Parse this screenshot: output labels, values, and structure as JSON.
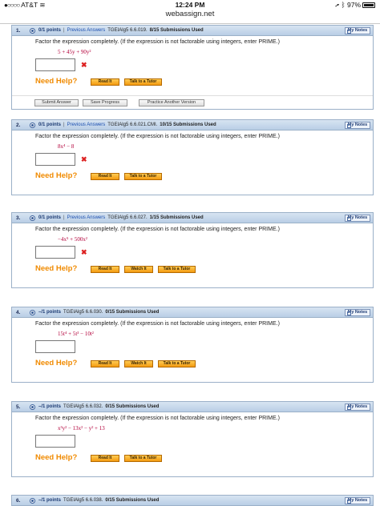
{
  "status": {
    "carrier": "AT&T",
    "time": "12:24 PM",
    "battery": "97%",
    "url": "webassign.net"
  },
  "common": {
    "prompt": "Factor the expression completely. (If the expression is not factorable using integers, enter PRIME.)",
    "need_help": "Need Help?",
    "read_it": "Read It",
    "watch_it": "Watch It",
    "talk_tutor": "Talk to a Tutor",
    "my_notes": "My Notes",
    "prev_answers": "Previous Answers",
    "sep": "|",
    "wrong_mark": "✖"
  },
  "actions": {
    "submit": "Submit Answer",
    "save": "Save Progress",
    "practice": "Practice Another Version"
  },
  "questions": [
    {
      "num": "1.",
      "points": "0/1 points",
      "code": "TGEIAlg5 6.6.019.",
      "subs": "8/15 Submissions Used",
      "expr": "5 + 45y + 90y²"
    },
    {
      "num": "2.",
      "points": "0/1 points",
      "code": "TGEIAlg5 6.6.021.CMI.",
      "subs": "10/15 Submissions Used",
      "expr": "8x⁴ − 8"
    },
    {
      "num": "3.",
      "points": "0/1 points",
      "code": "TGEIAlg5 6.6.027.",
      "subs": "1/15 Submissions Used",
      "expr": "−4x⁵ + 500x²"
    },
    {
      "num": "4.",
      "points": "–/1 points",
      "code": "TGEIAlg5 6.6.030.",
      "subs": "0/15 Submissions Used",
      "expr": "15t⁴ + 5t³ − 10t²"
    },
    {
      "num": "5.",
      "points": "–/1 points",
      "code": "TGEIAlg5 6.6.032.",
      "subs": "0/15 Submissions Used",
      "expr": "x³y² − 13x² − y² + 13"
    },
    {
      "num": "6.",
      "points": "–/1 points",
      "code": "TGEIAlg5 6.6.038.",
      "subs": "0/15 Submissions Used"
    }
  ]
}
